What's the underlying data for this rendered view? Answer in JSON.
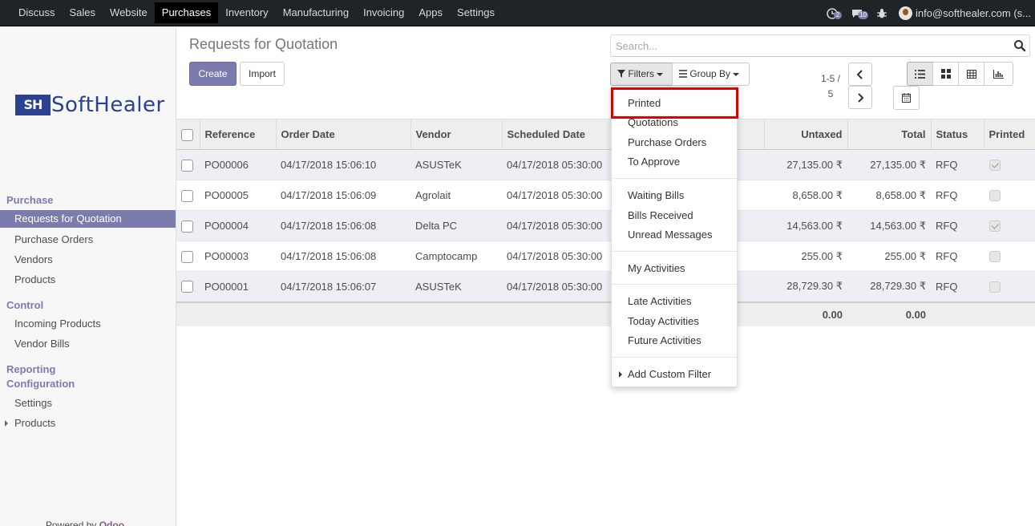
{
  "nav": {
    "menu": [
      "Discuss",
      "Sales",
      "Website",
      "Purchases",
      "Inventory",
      "Manufacturing",
      "Invoicing",
      "Apps",
      "Settings"
    ],
    "active": "Purchases",
    "activity_count": "2",
    "message_count": "10",
    "user": "info@softhealer.com (s..."
  },
  "sidebar": {
    "logo_mark": "SH",
    "logo_word": "SoftHealer",
    "section_purchase": "Purchase",
    "items_purchase": [
      "Requests for Quotation",
      "Purchase Orders",
      "Vendors",
      "Products"
    ],
    "section_control": "Control",
    "items_control": [
      "Incoming Products",
      "Vendor Bills"
    ],
    "section_reporting": "Reporting",
    "section_configuration": "Configuration",
    "items_configuration": [
      "Settings",
      "Products"
    ],
    "powered_by": "Powered by",
    "powered_brand": "Odoo"
  },
  "control": {
    "title": "Requests for Quotation",
    "create_label": "Create",
    "import_label": "Import",
    "search_placeholder": "Search...",
    "filters_label": "Filters",
    "groupby_label": "Group By",
    "pager_line1": "1-5 /",
    "pager_line2": "5"
  },
  "table": {
    "columns": [
      "Reference",
      "Order Date",
      "Vendor",
      "Scheduled Date",
      "Untaxed",
      "Total",
      "Status",
      "Printed"
    ],
    "rows": [
      {
        "ref": "PO00006",
        "order": "04/17/2018 15:06:10",
        "vendor": "ASUSTeK",
        "sched": "04/17/2018 05:30:00",
        "untaxed": "27,135.00 ₹",
        "total": "27,135.00 ₹",
        "status": "RFQ",
        "printed": true
      },
      {
        "ref": "PO00005",
        "order": "04/17/2018 15:06:09",
        "vendor": "Agrolait",
        "sched": "04/17/2018 05:30:00",
        "untaxed": "8,658.00 ₹",
        "total": "8,658.00 ₹",
        "status": "RFQ",
        "printed": false
      },
      {
        "ref": "PO00004",
        "order": "04/17/2018 15:06:08",
        "vendor": "Delta PC",
        "sched": "04/17/2018 05:30:00",
        "untaxed": "14,563.00 ₹",
        "total": "14,563.00 ₹",
        "status": "RFQ",
        "printed": true
      },
      {
        "ref": "PO00003",
        "order": "04/17/2018 15:06:08",
        "vendor": "Camptocamp",
        "sched": "04/17/2018 05:30:00",
        "untaxed": "255.00 ₹",
        "total": "255.00 ₹",
        "status": "RFQ",
        "printed": false
      },
      {
        "ref": "PO00001",
        "order": "04/17/2018 15:06:07",
        "vendor": "ASUSTeK",
        "sched": "04/17/2018 05:30:00",
        "untaxed": "28,729.30 ₹",
        "total": "28,729.30 ₹",
        "status": "RFQ",
        "printed": false
      }
    ],
    "footer_untaxed": "0.00",
    "footer_total": "0.00"
  },
  "filters_menu": {
    "group1": [
      "Printed",
      "Quotations",
      "Purchase Orders",
      "To Approve"
    ],
    "group2": [
      "Waiting Bills",
      "Bills Received",
      "Unread Messages"
    ],
    "group3": [
      "My Activities"
    ],
    "group4": [
      "Late Activities",
      "Today Activities",
      "Future Activities"
    ],
    "custom": "Add Custom Filter"
  }
}
